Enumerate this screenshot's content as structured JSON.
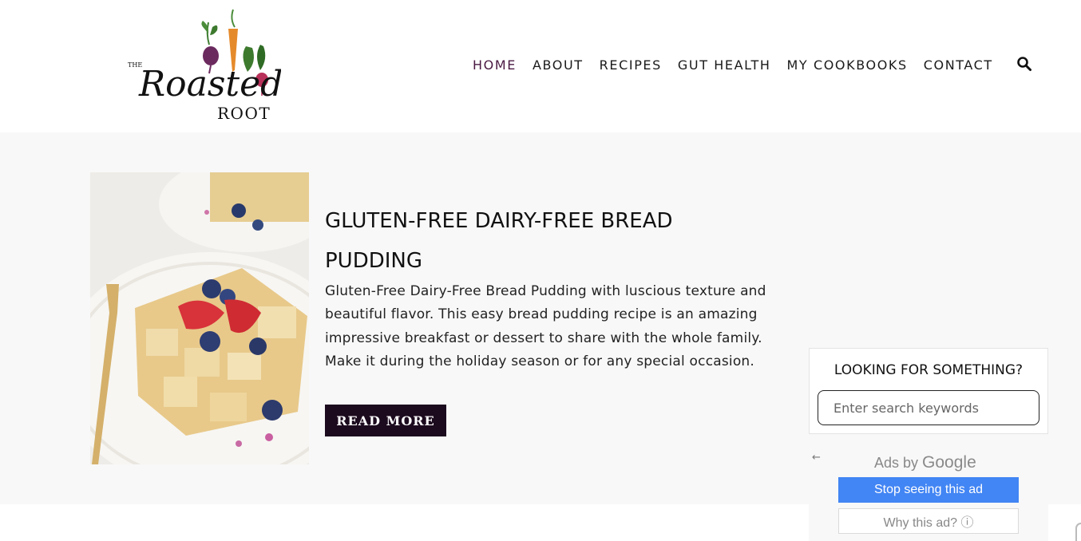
{
  "header": {
    "logo": {
      "small_text": "THE",
      "script_text": "Roasted",
      "caps_text": "ROOT"
    },
    "nav": [
      {
        "label": "HOME",
        "active": true
      },
      {
        "label": "ABOUT",
        "active": false
      },
      {
        "label": "RECIPES",
        "active": false
      },
      {
        "label": "GUT HEALTH",
        "active": false
      },
      {
        "label": "MY COOKBOOKS",
        "active": false
      },
      {
        "label": "CONTACT",
        "active": false
      }
    ],
    "search_icon": "search-icon"
  },
  "post": {
    "title": "GLUTEN-FREE DAIRY-FREE BREAD PUDDING",
    "excerpt": "Gluten-Free Dairy-Free Bread Pudding with luscious texture and beautiful flavor. This easy bread pudding recipe is an amazing impressive breakfast or dessert to share with the whole family. Make it during the holiday season or for any special occasion.",
    "read_more_label": "READ MORE"
  },
  "sidebar": {
    "widget_title": "LOOKING FOR SOMETHING?",
    "search_placeholder": "Enter search keywords"
  },
  "ad": {
    "back_icon": "arrow-left-icon",
    "ads_by_label": "Ads by",
    "google_label": "Google",
    "stop_label": "Stop seeing this ad",
    "why_label": "Why this ad? ⓘ"
  },
  "colors": {
    "nav_active": "#4a1942",
    "read_more_bg": "#1c0a1e",
    "band_bg": "#f8f8f8",
    "stop_button_bg": "#4285f4"
  }
}
